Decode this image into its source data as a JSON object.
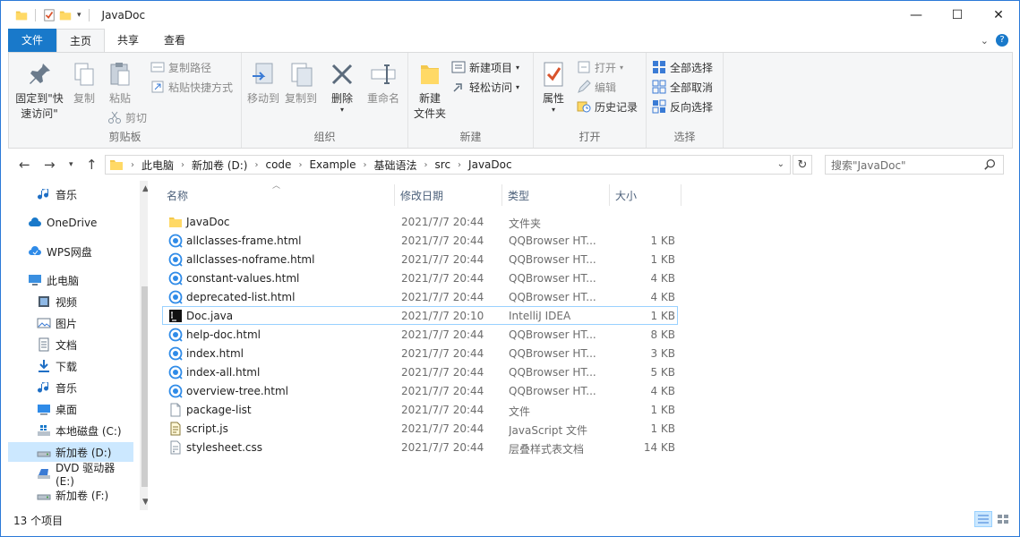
{
  "window": {
    "title": "JavaDoc",
    "minimize": "—",
    "maximize": "☐",
    "close": "✕"
  },
  "ribbon_tabs": {
    "file": "文件",
    "home": "主页",
    "share": "共享",
    "view": "查看",
    "expand": "⌄",
    "help": "?"
  },
  "ribbon": {
    "clipboard": {
      "label": "剪贴板",
      "pin_line1": "固定到\"快",
      "pin_line2": "速访问\"",
      "copy": "复制",
      "paste": "粘贴",
      "copy_path": "复制路径",
      "paste_shortcut": "粘贴快捷方式",
      "cut": "剪切"
    },
    "organize": {
      "label": "组织",
      "move_to": "移动到",
      "copy_to": "复制到",
      "delete": "删除",
      "rename": "重命名"
    },
    "new": {
      "label": "新建",
      "new_folder_line1": "新建",
      "new_folder_line2": "文件夹",
      "new_item": "新建项目",
      "easy_access": "轻松访问"
    },
    "open": {
      "label": "打开",
      "properties": "属性",
      "open": "打开",
      "edit": "编辑",
      "history": "历史记录"
    },
    "select": {
      "label": "选择",
      "select_all": "全部选择",
      "select_none": "全部取消",
      "invert": "反向选择"
    }
  },
  "address": {
    "crumbs": [
      "此电脑",
      "新加卷 (D:)",
      "code",
      "Example",
      "基础语法",
      "src",
      "JavaDoc"
    ],
    "search_placeholder": "搜索\"JavaDoc\""
  },
  "nav": {
    "items": [
      {
        "label": "音乐",
        "icon": "music-icon",
        "indent": 1
      },
      {
        "label": "OneDrive",
        "icon": "cloud-icon",
        "indent": 0
      },
      {
        "label": "WPS网盘",
        "icon": "wps-cloud-icon",
        "indent": 0
      },
      {
        "label": "此电脑",
        "icon": "computer-icon",
        "indent": 0
      },
      {
        "label": "视频",
        "icon": "video-icon",
        "indent": 1
      },
      {
        "label": "图片",
        "icon": "picture-icon",
        "indent": 1
      },
      {
        "label": "文档",
        "icon": "document-icon",
        "indent": 1
      },
      {
        "label": "下载",
        "icon": "download-icon",
        "indent": 1
      },
      {
        "label": "音乐",
        "icon": "music-icon",
        "indent": 1
      },
      {
        "label": "桌面",
        "icon": "desktop-icon",
        "indent": 1
      },
      {
        "label": "本地磁盘 (C:)",
        "icon": "windows-drive-icon",
        "indent": 1
      },
      {
        "label": "新加卷 (D:)",
        "icon": "drive-icon",
        "indent": 1,
        "selected": true
      },
      {
        "label": "DVD 驱动器 (E:)",
        "icon": "dvd-icon",
        "indent": 1
      },
      {
        "label": "新加卷 (F:)",
        "icon": "drive-icon",
        "indent": 1
      }
    ]
  },
  "columns": {
    "name": "名称",
    "modified": "修改日期",
    "type": "类型",
    "size": "大小"
  },
  "files": [
    {
      "name": "JavaDoc",
      "modified": "2021/7/7 20:44",
      "type": "文件夹",
      "size": "",
      "icon": "folder-icon"
    },
    {
      "name": "allclasses-frame.html",
      "modified": "2021/7/7 20:44",
      "type": "QQBrowser HT...",
      "size": "1 KB",
      "icon": "browser-html-icon"
    },
    {
      "name": "allclasses-noframe.html",
      "modified": "2021/7/7 20:44",
      "type": "QQBrowser HT...",
      "size": "1 KB",
      "icon": "browser-html-icon"
    },
    {
      "name": "constant-values.html",
      "modified": "2021/7/7 20:44",
      "type": "QQBrowser HT...",
      "size": "4 KB",
      "icon": "browser-html-icon"
    },
    {
      "name": "deprecated-list.html",
      "modified": "2021/7/7 20:44",
      "type": "QQBrowser HT...",
      "size": "4 KB",
      "icon": "browser-html-icon"
    },
    {
      "name": "Doc.java",
      "modified": "2021/7/7 20:10",
      "type": "IntelliJ IDEA",
      "size": "1 KB",
      "icon": "intellij-icon",
      "highlight": true
    },
    {
      "name": "help-doc.html",
      "modified": "2021/7/7 20:44",
      "type": "QQBrowser HT...",
      "size": "8 KB",
      "icon": "browser-html-icon"
    },
    {
      "name": "index.html",
      "modified": "2021/7/7 20:44",
      "type": "QQBrowser HT...",
      "size": "3 KB",
      "icon": "browser-html-icon"
    },
    {
      "name": "index-all.html",
      "modified": "2021/7/7 20:44",
      "type": "QQBrowser HT...",
      "size": "5 KB",
      "icon": "browser-html-icon"
    },
    {
      "name": "overview-tree.html",
      "modified": "2021/7/7 20:44",
      "type": "QQBrowser HT...",
      "size": "4 KB",
      "icon": "browser-html-icon"
    },
    {
      "name": "package-list",
      "modified": "2021/7/7 20:44",
      "type": "文件",
      "size": "1 KB",
      "icon": "blank-file-icon"
    },
    {
      "name": "script.js",
      "modified": "2021/7/7 20:44",
      "type": "JavaScript 文件",
      "size": "1 KB",
      "icon": "script-file-icon"
    },
    {
      "name": "stylesheet.css",
      "modified": "2021/7/7 20:44",
      "type": "层叠样式表文档",
      "size": "14 KB",
      "icon": "css-file-icon"
    }
  ],
  "status": {
    "count": "13 个项目"
  },
  "colors": {
    "accent": "#1979ca",
    "selection": "#cce8ff",
    "highlight_border": "#99d1ff"
  }
}
